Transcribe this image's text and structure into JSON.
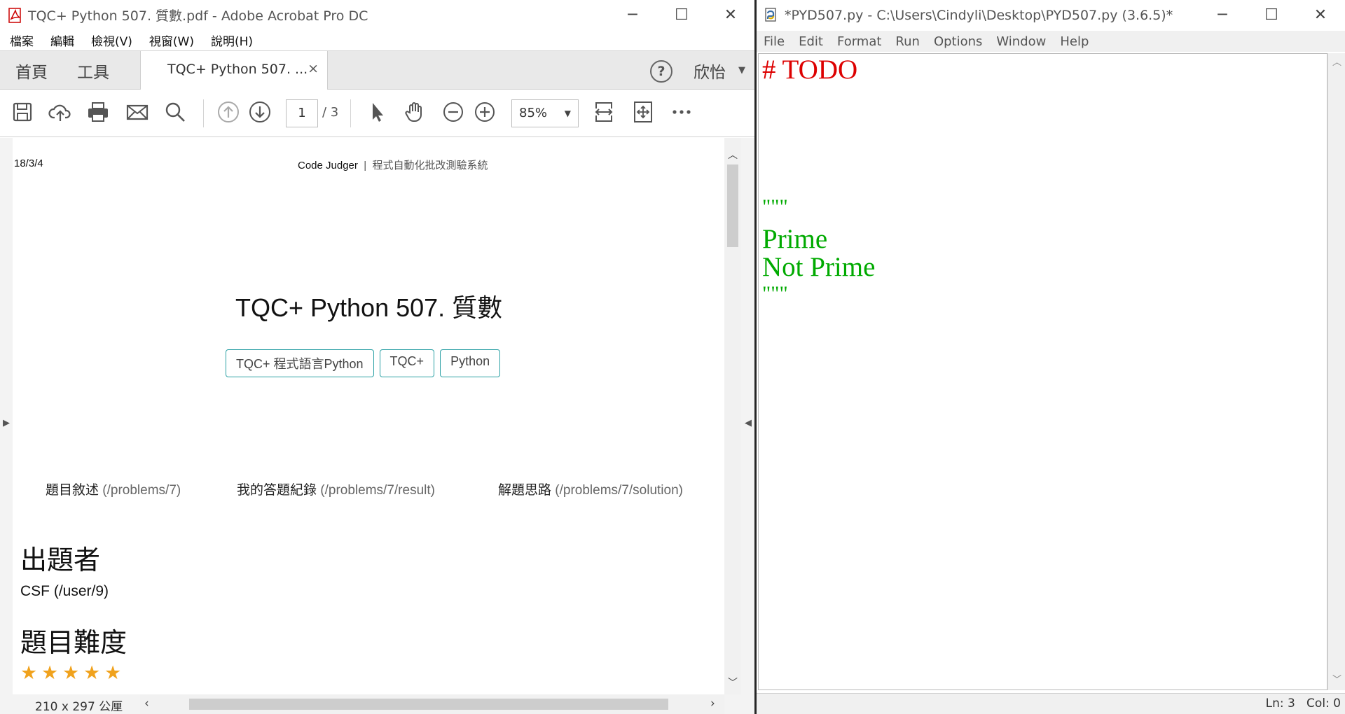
{
  "acrobat": {
    "window_title": "TQC+ Python 507. 質數.pdf - Adobe Acrobat Pro DC",
    "menu": [
      "檔案",
      "編輯",
      "檢視(V)",
      "視窗(W)",
      "說明(H)"
    ],
    "tabs": {
      "home": "首頁",
      "tools": "工具",
      "doc_tab": "TQC+ Python 507. ...",
      "close": "×"
    },
    "help": "?",
    "user": "欣怡",
    "toolbar": {
      "page_current": "1",
      "page_total": "/ 3",
      "zoom": "85%"
    },
    "pdf": {
      "date": "18/3/4",
      "header_site": "Code Judger",
      "header_sep": "|",
      "header_sub": "程式自動化批改測驗系統",
      "title": "TQC+ Python 507. 質數",
      "tags": [
        "TQC+ 程式語言Python",
        "TQC+",
        "Python"
      ],
      "links": [
        {
          "label": "題目敘述",
          "url": "(/problems/7)"
        },
        {
          "label": "我的答題紀錄",
          "url": "(/problems/7/result)"
        },
        {
          "label": "解題思路",
          "url": "(/problems/7/solution)"
        }
      ],
      "author_heading": "出題者",
      "author": "CSF (/user/9)",
      "difficulty_heading": "題目難度",
      "difficulty_stars": 5
    },
    "status_dims": "210 x 297 公厘"
  },
  "idle": {
    "window_title": "*PYD507.py - C:\\Users\\Cindyli\\Desktop\\PYD507.py (3.6.5)*",
    "menu": [
      "File",
      "Edit",
      "Format",
      "Run",
      "Options",
      "Window",
      "Help"
    ],
    "code": [
      {
        "text": "# TODO",
        "color": "#dd0000"
      },
      {
        "text": "\"\"\"",
        "color": "#00aa00"
      },
      {
        "text": "Prime",
        "color": "#00aa00"
      },
      {
        "text": "Not Prime",
        "color": "#00aa00"
      },
      {
        "text": "\"\"\"",
        "color": "#00aa00"
      }
    ],
    "status": "Ln: 3   Col: 0"
  },
  "colors": {
    "tag_border": "#2aa0a4",
    "star": "#f0a21d",
    "comment": "#dd0000",
    "string": "#00aa00"
  }
}
